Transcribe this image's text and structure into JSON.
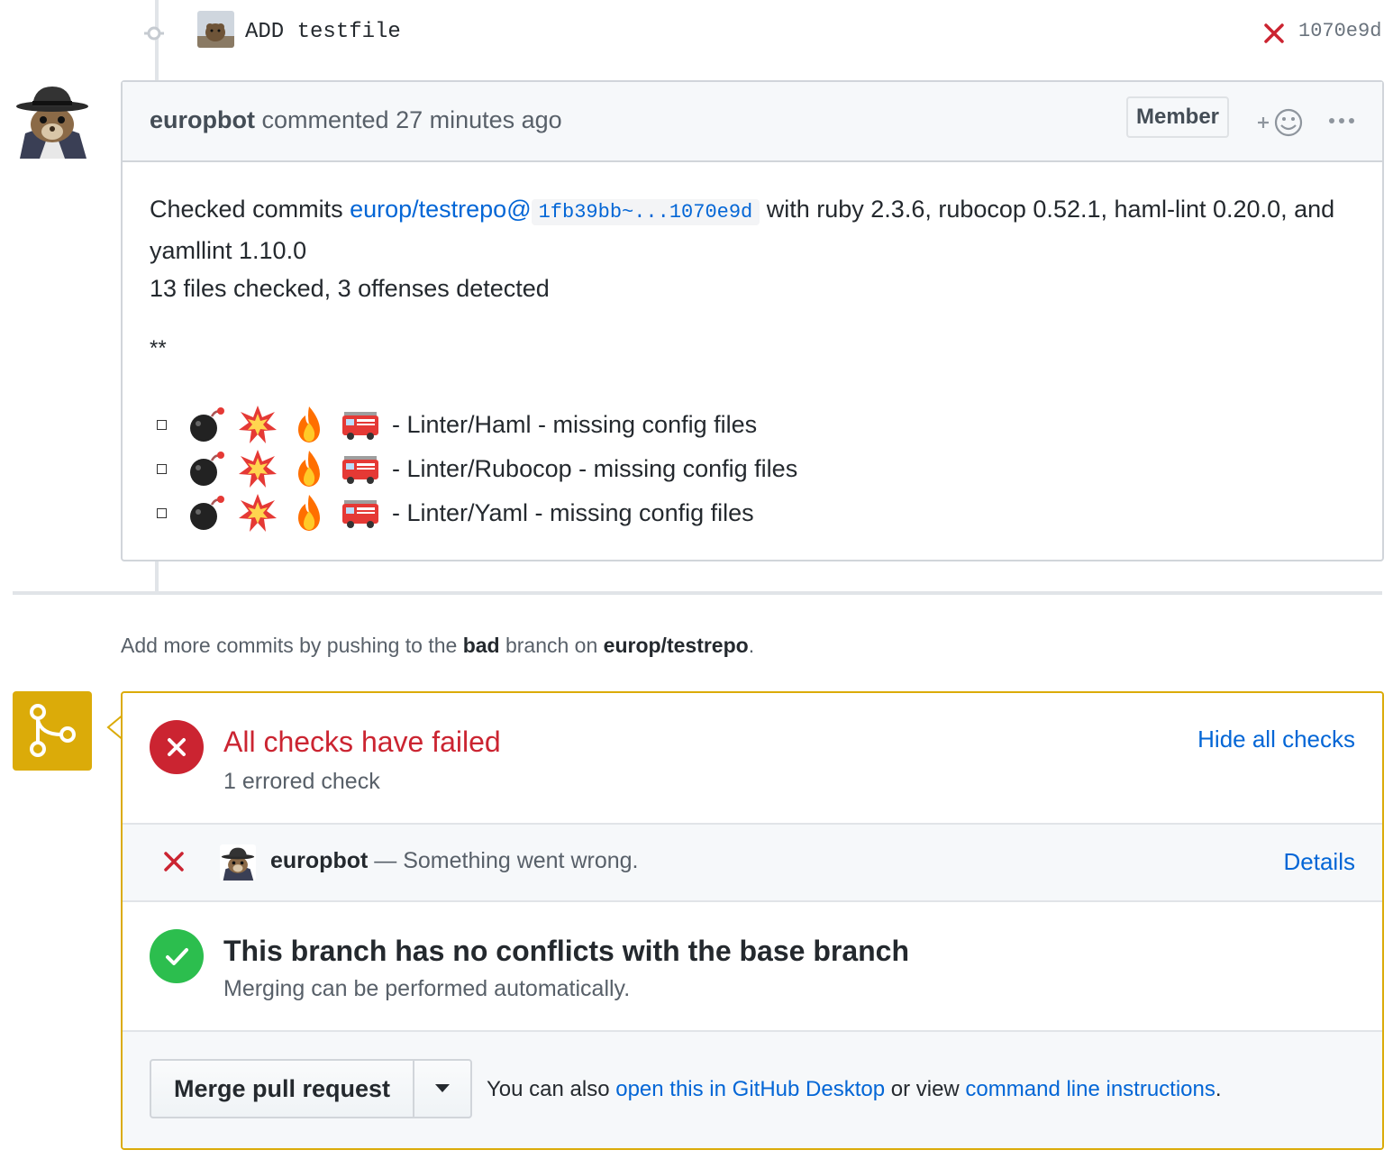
{
  "commit": {
    "message": "ADD testfile",
    "sha": "1070e9d",
    "status": "failed"
  },
  "comment": {
    "author": "europbot",
    "action": "commented 27 minutes ago",
    "badge": "Member",
    "body": {
      "prefix": "Checked commits ",
      "repo_link": "europ/testrepo@",
      "sha_range": "1fb39bb~...1070e9d",
      "suffix": " with ruby 2.3.6, rubocop 0.52.1, haml-lint 0.20.0, and yamllint 1.10.0",
      "summary": "13 files checked, 3 offenses detected",
      "stars": "**"
    },
    "offenses": [
      {
        "text": "- Linter/Haml - missing config files"
      },
      {
        "text": "- Linter/Rubocop - missing config files"
      },
      {
        "text": "- Linter/Yaml - missing config files"
      }
    ],
    "emoji_icons": [
      "bomb-icon",
      "collision-icon",
      "fire-icon",
      "fire-engine-icon"
    ]
  },
  "add_more": {
    "prefix": "Add more commits by pushing to the ",
    "branch": "bad",
    "middle": " branch on ",
    "repo": "europ/testrepo",
    "end": "."
  },
  "checks": {
    "title": "All checks have failed",
    "subtitle": "1 errored check",
    "toggle_link": "Hide all checks",
    "items": [
      {
        "name": "europbot",
        "description": "— Something went wrong.",
        "link": "Details",
        "status": "error"
      }
    ]
  },
  "conflicts": {
    "title": "This branch has no conflicts with the base branch",
    "subtitle": "Merging can be performed automatically."
  },
  "merge": {
    "button": "Merge pull request",
    "also_prefix": "You can also ",
    "desktop_link": "open this in GitHub Desktop",
    "middle": " or view ",
    "cli_link": "command line instructions",
    "end": "."
  },
  "colors": {
    "fail": "#cb2431",
    "success": "#2cbe4e",
    "link": "#0366d6",
    "merge_accent": "#dbab09"
  }
}
